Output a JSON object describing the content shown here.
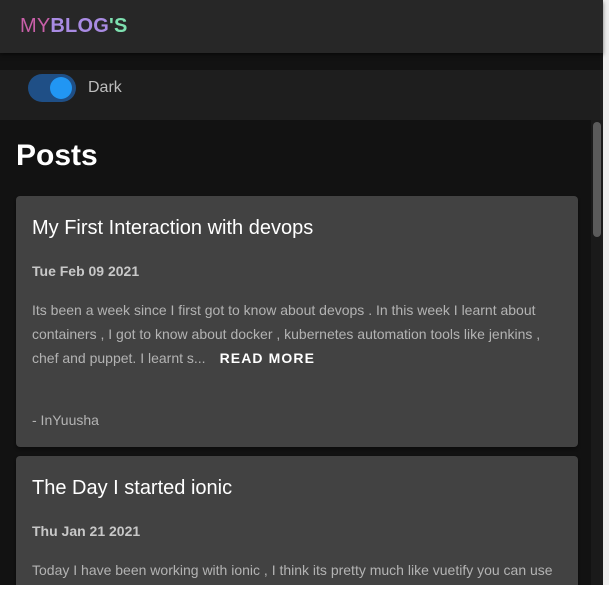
{
  "brand": {
    "my": "MY",
    "blog": "BLOG",
    "s": "'S"
  },
  "theme_toggle": {
    "label": "Dark",
    "on": true
  },
  "page": {
    "title": "Posts"
  },
  "posts": [
    {
      "title": "My First Interaction with devops",
      "date": "Tue Feb 09 2021",
      "excerpt": "Its been a week since I first got to know about devops . In this week I learnt about containers , I got to know about docker , kubernetes automation tools like jenkins , chef and puppet. I learnt s...",
      "read_more": "READ MORE",
      "author": "- InYuusha"
    },
    {
      "title": "The Day I started ionic",
      "date": "Thu Jan 21 2021",
      "excerpt": "Today I have been working with ionic , I think its pretty much like vuetify you can use"
    }
  ],
  "colors": {
    "brand_my": "#c85fa8",
    "brand_blog": "#a98be3",
    "brand_s": "#7ee0b0",
    "switch_knob": "#2196f3",
    "card_bg": "#424242",
    "page_bg": "#121212"
  }
}
